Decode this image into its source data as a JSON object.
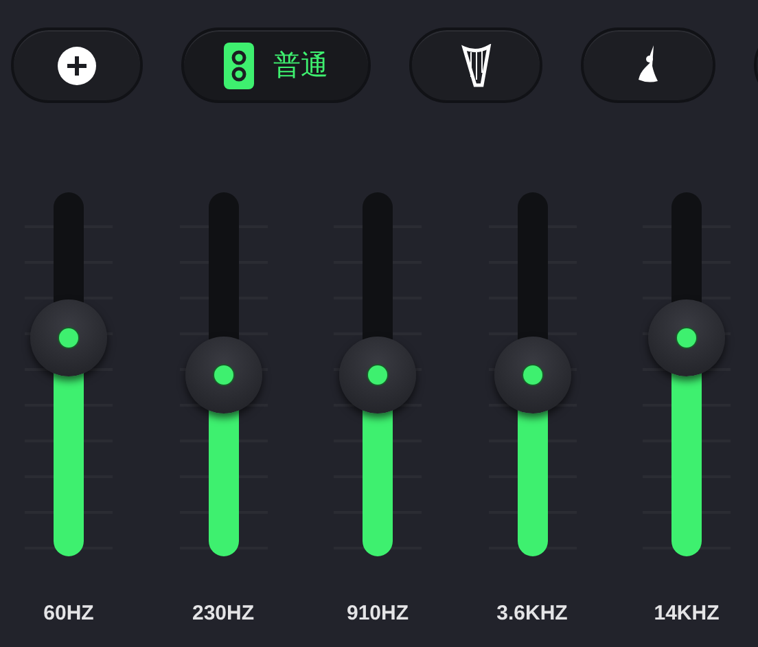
{
  "presets": [
    {
      "kind": "add",
      "selected": false
    },
    {
      "kind": "preset",
      "label": "普通",
      "selected": true
    },
    {
      "kind": "harp",
      "selected": false
    },
    {
      "kind": "dancer",
      "selected": false
    },
    {
      "kind": "blank"
    }
  ],
  "bands": [
    {
      "label": "60HZ",
      "level": 0.6
    },
    {
      "label": "230HZ",
      "level": 0.5
    },
    {
      "label": "910HZ",
      "level": 0.5
    },
    {
      "label": "3.6KHZ",
      "level": 0.5
    },
    {
      "label": "14KHZ",
      "level": 0.6
    }
  ]
}
